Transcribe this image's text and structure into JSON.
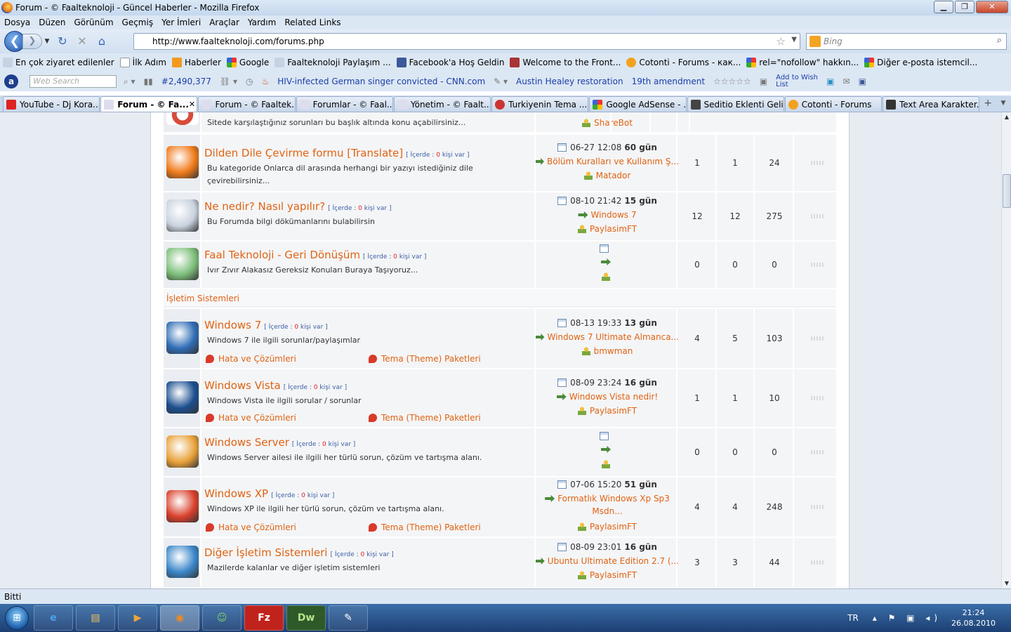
{
  "window": {
    "title": "Forum - © Faalteknoloji - Güncel Haberler - Mozilla Firefox"
  },
  "menu": [
    "Dosya",
    "Düzen",
    "Görünüm",
    "Geçmiş",
    "Yer İmleri",
    "Araçlar",
    "Yardım",
    "Related Links"
  ],
  "nav": {
    "url": "http://www.faalteknoloji.com/forums.php",
    "search_placeholder": "Bing"
  },
  "bookmarks": [
    "En çok ziyaret edilenler",
    "İlk Adım",
    "Haberler",
    "Google",
    "Faalteknoloji Paylaşım ...",
    "Facebook'a Hoş Geldin",
    "Welcome to the Front...",
    "Cotonti - Forums - как...",
    "rel=\"nofollow\" hakkın...",
    "Diğer e-posta istemcil..."
  ],
  "toolbar2": {
    "web_search": "Web Search",
    "count": "#2,490,377",
    "news1": "HIV-infected German singer convicted - CNN.com",
    "news2": "Austin Healey restoration",
    "news3": "19th amendment",
    "wishlist": "Add to Wish List"
  },
  "tabs": [
    {
      "label": "YouTube - Dj Kora...",
      "active": false
    },
    {
      "label": "Forum - © Fa...",
      "active": true
    },
    {
      "label": "Forum - © Faaltek...",
      "active": false
    },
    {
      "label": "Forumlar - © Faal...",
      "active": false
    },
    {
      "label": "Yönetim - © Faalt...",
      "active": false
    },
    {
      "label": "Turkiyenin Tema ...",
      "active": false
    },
    {
      "label": "Google AdSense - ...",
      "active": false
    },
    {
      "label": "Seditio Eklenti Geli...",
      "active": false
    },
    {
      "label": "Cotonti - Forums",
      "active": false
    },
    {
      "label": "Text Area Karakter...",
      "active": false
    }
  ],
  "forum": {
    "inside_label": "İçerde :",
    "people_label": "kişi var",
    "top_partial": {
      "desc": "Sitede karşılaştığınız sorunları bu başlık altında konu açabilirsiniz...",
      "user": "ShareBot"
    },
    "rows_a": [
      {
        "name": "Dilden Dile Çevirme formu [Translate]",
        "online": "0",
        "desc": "Bu kategoride Onlarca dil arasında herhangi bir yazıyı istediğiniz dile çevirebilirsiniz...",
        "date": "06-27 12:08",
        "ago": "60 gün",
        "topic": "Bölüm Kuralları ve Kullanım Ş...",
        "topic2": "",
        "user": "Matador",
        "topics": "1",
        "posts": "1",
        "views": "24",
        "color": "#f07a1a"
      },
      {
        "name": "Ne nedir? Nasıl yapılır?",
        "online": "0",
        "desc": "Bu Forumda bilgi dökümanlarını bulabilirsin",
        "date": "08-10 21:42",
        "ago": "15 gün",
        "topic": "Windows 7",
        "topic2": "",
        "user": "PaylasimFT",
        "topics": "12",
        "posts": "12",
        "views": "275",
        "color": "#c9d2de"
      },
      {
        "name": "Faal Teknoloji - Geri Dönüşüm",
        "online": "0",
        "desc": "Ivır Zıvır Alakasız Gereksiz Konuları Buraya Taşıyoruz...",
        "date": "",
        "ago": "",
        "topic": "",
        "topic2": "",
        "user": "",
        "topics": "0",
        "posts": "0",
        "views": "0",
        "color": "#7dbf7a"
      }
    ],
    "category": "İşletim Sistemleri",
    "subforum_a": "Hata ve Çözümleri",
    "subforum_b": "Tema (Theme) Paketleri",
    "rows_b": [
      {
        "name": "Windows 7",
        "online": "0",
        "desc": "Windows 7 ile ilgili sorunlar/paylaşımlar",
        "date": "08-13 19:33",
        "ago": "13 gün",
        "topic": "Windows 7 Ultimate Almanca...",
        "topic2": "",
        "user": "bmwman",
        "topics": "4",
        "posts": "5",
        "views": "103",
        "color": "#2f6db5"
      },
      {
        "name": "Windows Vista",
        "online": "0",
        "desc": "Windows Vista ile ilgili sorular / sorunlar",
        "date": "08-09 23:24",
        "ago": "16 gün",
        "topic": "Windows Vista nedir!",
        "topic2": "",
        "user": "PaylasimFT",
        "topics": "1",
        "posts": "1",
        "views": "10",
        "color": "#1b4f8f"
      },
      {
        "name": "Windows Server",
        "online": "0",
        "desc": "Windows Server ailesi ile ilgili her türlü sorun, çözüm ve tartışma alanı.",
        "date": "",
        "ago": "",
        "topic": "",
        "topic2": "",
        "user": "",
        "topics": "0",
        "posts": "0",
        "views": "0",
        "color": "#e9a23b"
      },
      {
        "name": "Windows XP",
        "online": "0",
        "desc": "Windows XP ile ilgili her türlü sorun, çözüm ve tartışma alanı.",
        "date": "07-06 15:20",
        "ago": "51 gün",
        "topic": "Formatlık Windows Xp Sp3",
        "topic2": "Msdn...",
        "user": "PaylasimFT",
        "topics": "4",
        "posts": "4",
        "views": "248",
        "color": "#d9402c"
      },
      {
        "name": "Diğer İşletim Sistemleri",
        "online": "0",
        "desc": "Mazilerde kalanlar ve diğer işletim sistemleri",
        "date": "08-09 23:01",
        "ago": "16 gün",
        "topic": "Ubuntu Ultimate Edition 2.7 (...",
        "topic2": "",
        "user": "PaylasimFT",
        "topics": "3",
        "posts": "3",
        "views": "44",
        "color": "#3a86c8"
      }
    ]
  },
  "status": "Bitti",
  "taskbar": {
    "lang": "TR",
    "time": "21:24",
    "date": "26.08.2010"
  }
}
